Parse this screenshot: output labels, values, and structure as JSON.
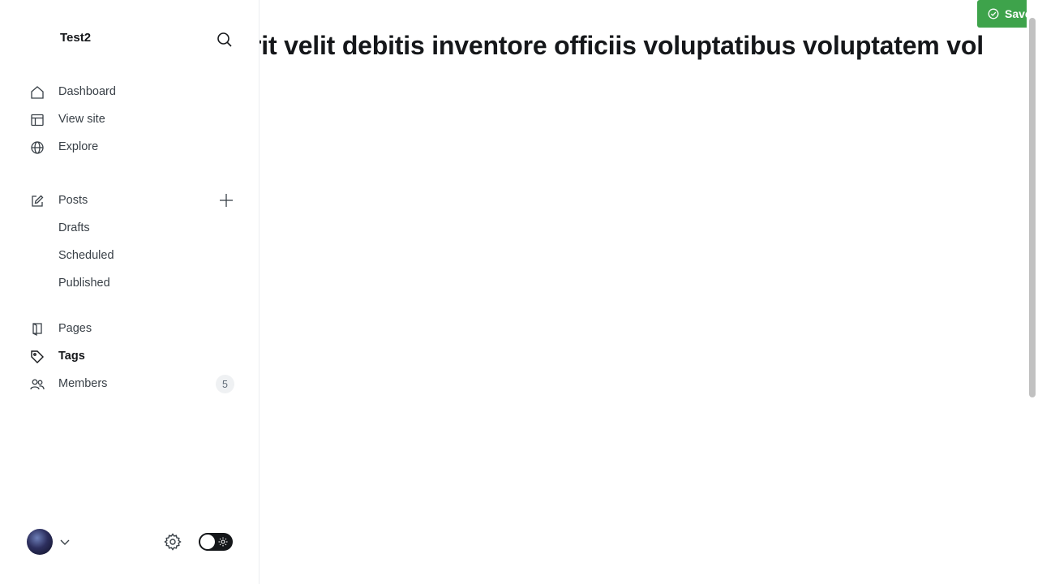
{
  "sidebar": {
    "site_title": "Test2",
    "primary_nav": [
      {
        "label": "Dashboard",
        "icon": "home-icon"
      },
      {
        "label": "View site",
        "icon": "layout-icon"
      },
      {
        "label": "Explore",
        "icon": "globe-icon"
      }
    ],
    "posts": {
      "label": "Posts",
      "icon": "edit-icon",
      "sub_items": [
        "Drafts",
        "Scheduled",
        "Published"
      ]
    },
    "secondary_nav": [
      {
        "label": "Pages",
        "icon": "pages-icon"
      },
      {
        "label": "Tags",
        "icon": "tag-icon",
        "active": true
      },
      {
        "label": "Members",
        "icon": "members-icon",
        "count": "5"
      }
    ]
  },
  "editor": {
    "title_text": "rit velit debitis inventore officiis voluptatibus voluptatem vol"
  },
  "toolbar": {
    "save_label": "Save"
  },
  "colors": {
    "accent_green": "#3ea34b",
    "text_dark": "#15171a",
    "text_muted": "#394047"
  }
}
